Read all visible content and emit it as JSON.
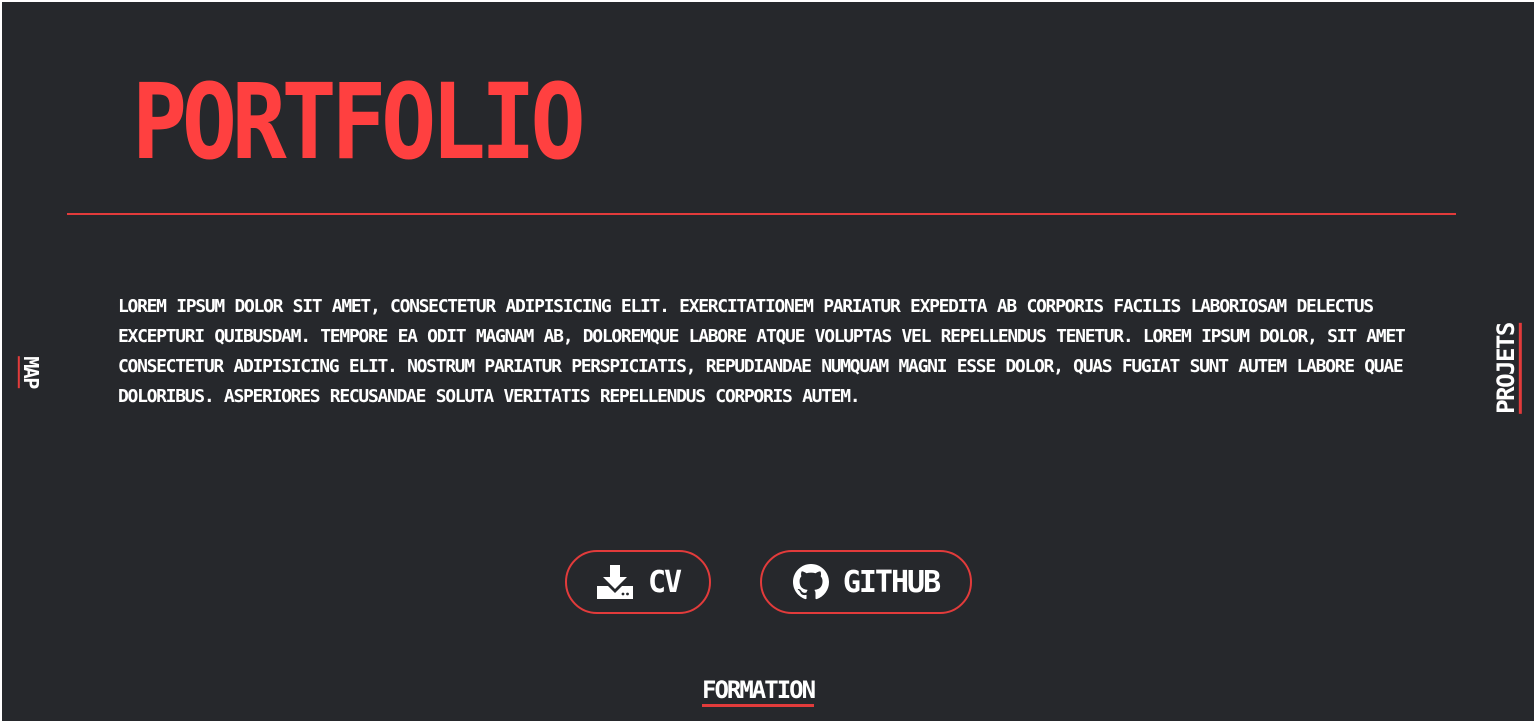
{
  "header": {
    "title": "PORTFOLIO"
  },
  "intro": {
    "text": "LOREM IPSUM DOLOR SIT AMET, CONSECTETUR ADIPISICING ELIT. EXERCITATIONEM PARIATUR EXPEDITA AB CORPORIS FACILIS LABORIOSAM DELECTUS EXCEPTURI QUIBUSDAM. TEMPORE EA ODIT MAGNAM AB, DOLOREMQUE LABORE ATQUE VOLUPTAS VEL REPELLENDUS TENETUR. LOREM IPSUM DOLOR, SIT AMET CONSECTETUR ADIPISICING ELIT. NOSTRUM PARIATUR PERSPICIATIS, REPUDIANDAE NUMQUAM MAGNI ESSE DOLOR, QUAS FUGIAT SUNT AUTEM LABORE QUAE DOLORIBUS. ASPERIORES RECUSANDAE SOLUTA VERITATIS REPELLENDUS CORPORIS AUTEM."
  },
  "nav": {
    "left_label": "MAP",
    "right_label": "PROJETS",
    "bottom_label": "FORMATION"
  },
  "buttons": {
    "cv": {
      "label": "CV",
      "icon": "download-icon"
    },
    "github": {
      "label": "GITHUB",
      "icon": "github-icon"
    }
  },
  "colors": {
    "background": "#26282c",
    "accent": "#ff4040",
    "text": "#ffffff"
  }
}
